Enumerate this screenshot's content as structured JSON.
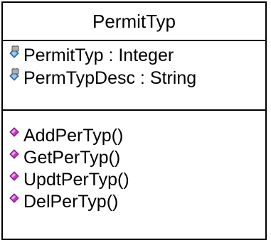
{
  "class": {
    "name": "PermitTyp",
    "attributes": [
      {
        "label": "PermitTyp : Integer",
        "icon": "protected-attribute-icon"
      },
      {
        "label": "PermTypDesc : String",
        "icon": "protected-attribute-icon"
      }
    ],
    "operations": [
      {
        "label": "AddPerTyp()",
        "icon": "public-operation-icon"
      },
      {
        "label": "GetPerTyp()",
        "icon": "public-operation-icon"
      },
      {
        "label": "UpdtPerTyp()",
        "icon": "public-operation-icon"
      },
      {
        "label": "DelPerTyp()",
        "icon": "public-operation-icon"
      }
    ]
  },
  "colors": {
    "border": "#000000",
    "attribute_icon": "#4a90d9",
    "lock": "#808080",
    "operation_icon": "#cc33cc"
  }
}
